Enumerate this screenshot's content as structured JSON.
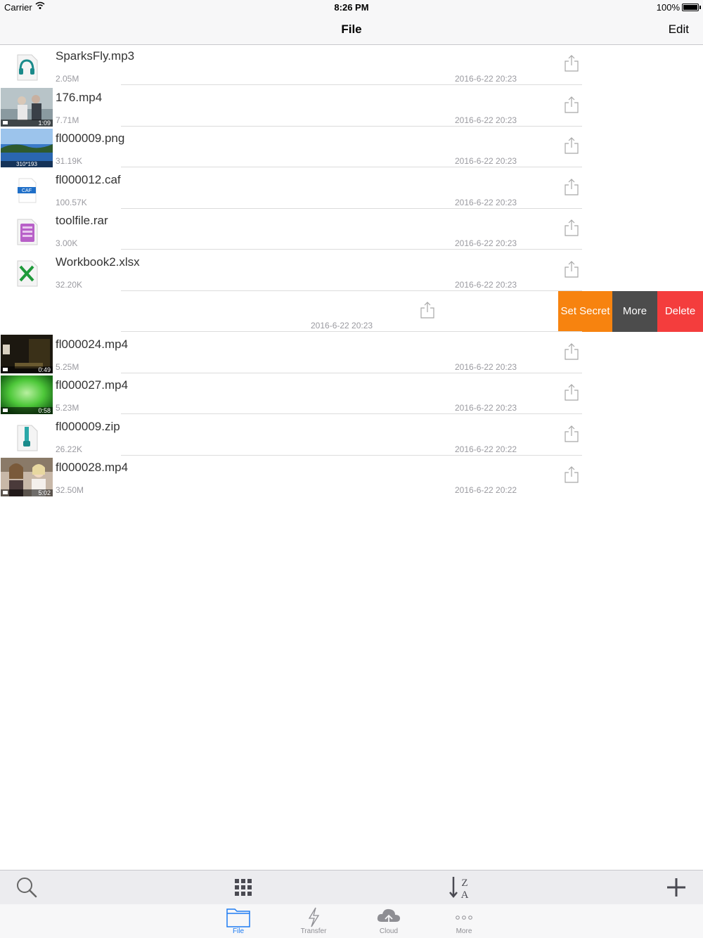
{
  "status_bar": {
    "carrier": "Carrier",
    "time": "8:26 PM",
    "battery": "100%"
  },
  "nav": {
    "title": "File",
    "edit_label": "Edit"
  },
  "files": [
    {
      "name": "SparksFly.mp3",
      "size": "2.05M",
      "date": "2016-6-22 20:23",
      "icon": "audio-file-icon"
    },
    {
      "name": "176.mp4",
      "size": "7.71M",
      "date": "2016-6-22 20:23",
      "icon": "video-thumbnail",
      "duration": "1:09"
    },
    {
      "name": "fl000009.png",
      "size": "31.19K",
      "date": "2016-6-22 20:23",
      "icon": "image-thumbnail",
      "dimensions": "310*193"
    },
    {
      "name": "fl000012.caf",
      "size": "100.57K",
      "date": "2016-6-22 20:23",
      "icon": "caf-file-icon",
      "badge": "CAF"
    },
    {
      "name": "toolfile.rar",
      "size": "3.00K",
      "date": "2016-6-22 20:23",
      "icon": "archive-file-icon"
    },
    {
      "name": "Workbook2.xlsx",
      "size": "32.20K",
      "date": "2016-6-22 20:23",
      "icon": "excel-file-icon"
    },
    {
      "name": "",
      "size": "",
      "date": "2016-6-22 20:23",
      "icon": "",
      "swiped": true
    },
    {
      "name": "fl000024.mp4",
      "size": "5.25M",
      "date": "2016-6-22 20:23",
      "icon": "video-thumbnail",
      "duration": "0:49"
    },
    {
      "name": "fl000027.mp4",
      "size": "5.23M",
      "date": "2016-6-22 20:23",
      "icon": "video-thumbnail",
      "duration": "0:58"
    },
    {
      "name": "fl000009.zip",
      "size": "26.22K",
      "date": "2016-6-22 20:22",
      "icon": "zip-file-icon"
    },
    {
      "name": "fl000028.mp4",
      "size": "32.50M",
      "date": "2016-6-22 20:22",
      "icon": "video-thumbnail",
      "duration": "5:02"
    }
  ],
  "swipe_actions": {
    "set_secret": "Set Secret",
    "more": "More",
    "delete": "Delete"
  },
  "toolbar": {
    "search_icon": "search-icon",
    "grid_icon": "grid-icon",
    "sort_icon": "sort-z-a-icon",
    "sort_z": "Z",
    "sort_a": "A",
    "add_icon": "plus-icon"
  },
  "tabs": [
    {
      "label": "File",
      "icon": "folder-icon",
      "active": true
    },
    {
      "label": "Transfer",
      "icon": "lightning-icon",
      "active": false
    },
    {
      "label": "Cloud",
      "icon": "cloud-upload-icon",
      "active": false
    },
    {
      "label": "More",
      "icon": "ellipsis-icon",
      "active": false
    }
  ],
  "colors": {
    "accent": "#1e7cf2",
    "set_secret": "#f7830f",
    "more": "#4c4c4c",
    "delete": "#f43d3d"
  }
}
